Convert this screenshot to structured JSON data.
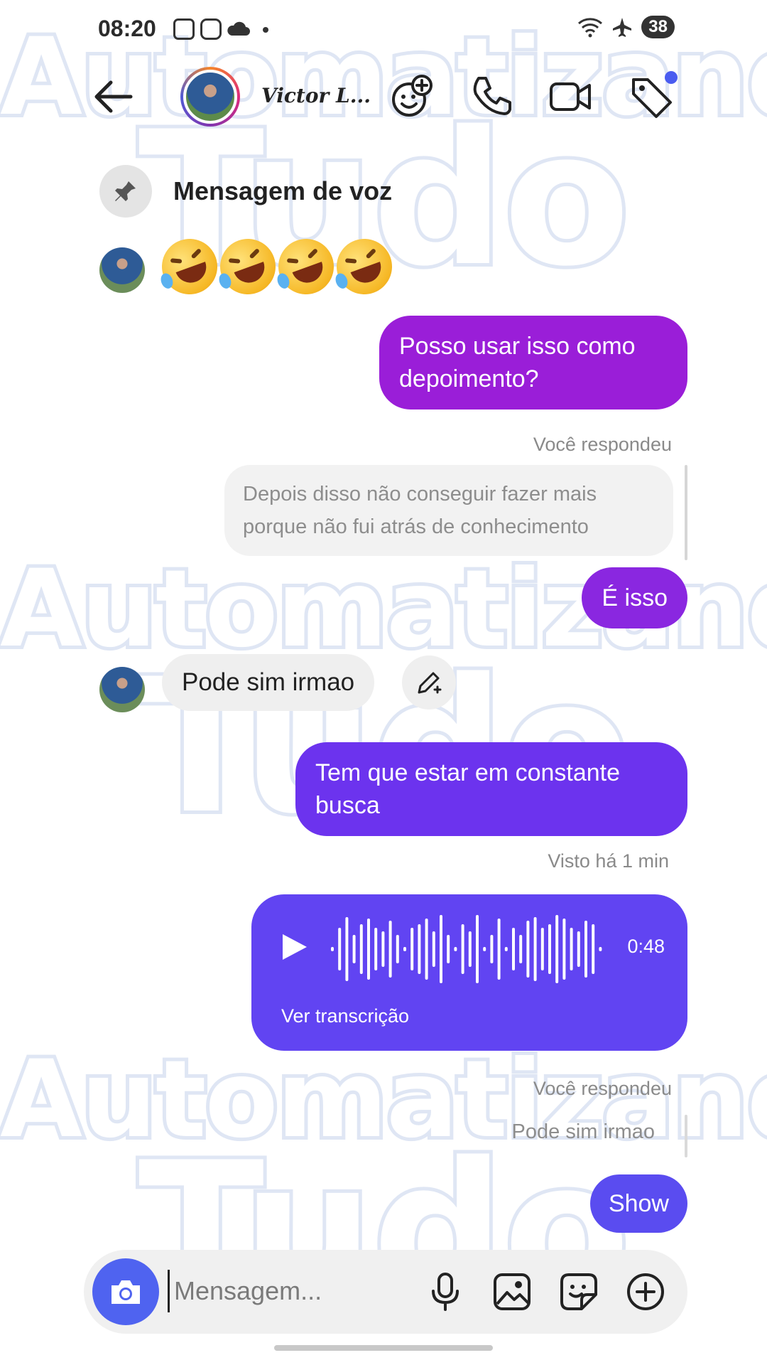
{
  "status_bar": {
    "time": "08:20",
    "battery": "38"
  },
  "header": {
    "contact_name": "Victor L..."
  },
  "watermark": {
    "line1": "Automatizando",
    "line2": "Tudo"
  },
  "pinned": {
    "label": "Mensagem de voz"
  },
  "messages": {
    "sent_1": "Posso usar isso como depoimento?",
    "replied_label": "Você respondeu",
    "quoted_text": "Depois disso não conseguir fazer mais porque não fui atrás de conhecimento",
    "sent_2": "É isso",
    "received_1": "Pode sim irmao",
    "sent_3": "Tem que estar em constante busca",
    "seen_label": "Visto há 1 min",
    "voice_duration": "0:48",
    "voice_transcription_link": "Ver transcrição",
    "replied_label_2": "Você respondeu",
    "quoted_text_2": "Pode sim irmao",
    "sent_4": "Show"
  },
  "composer": {
    "placeholder": "Mensagem..."
  },
  "colors": {
    "accent": "#4f63f0",
    "bubble_purple": "#9a1ed8",
    "bubble_violet": "#6c33ee",
    "bubble_blue": "#5a4cf0"
  }
}
